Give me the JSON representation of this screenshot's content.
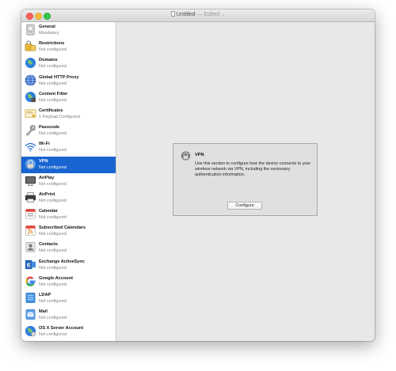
{
  "window": {
    "title": "Untitled",
    "edited": "— Edited",
    "chevron": "⌄"
  },
  "sidebar": {
    "items": [
      {
        "name": "General",
        "status": "Mandatory",
        "icon": "general-icon"
      },
      {
        "name": "Restrictions",
        "status": "Not configured",
        "icon": "restrictions-icon"
      },
      {
        "name": "Domains",
        "status": "Not configured",
        "icon": "domains-icon"
      },
      {
        "name": "Global HTTP Proxy",
        "status": "Not configured",
        "icon": "globe-icon"
      },
      {
        "name": "Content Filter",
        "status": "Not configured",
        "icon": "content-filter-icon"
      },
      {
        "name": "Certificates",
        "status": "1 Payload Configured",
        "icon": "certificate-icon"
      },
      {
        "name": "Passcode",
        "status": "Not configured",
        "icon": "key-icon"
      },
      {
        "name": "Wi-Fi",
        "status": "Not configured",
        "icon": "wifi-icon"
      },
      {
        "name": "VPN",
        "status": "Not configured",
        "icon": "vpn-lock-icon",
        "selected": true
      },
      {
        "name": "AirPlay",
        "status": "Not configured",
        "icon": "airplay-icon"
      },
      {
        "name": "AirPrint",
        "status": "Not configured",
        "icon": "printer-icon"
      },
      {
        "name": "Calendar",
        "status": "Not configured",
        "icon": "calendar-icon"
      },
      {
        "name": "Subscribed Calendars",
        "status": "Not configured",
        "icon": "subscribed-calendar-icon"
      },
      {
        "name": "Contacts",
        "status": "Not configured",
        "icon": "contacts-icon"
      },
      {
        "name": "Exchange ActiveSync",
        "status": "Not configured",
        "icon": "exchange-icon"
      },
      {
        "name": "Google Account",
        "status": "Not configured",
        "icon": "google-icon"
      },
      {
        "name": "LDAP",
        "status": "Not configured",
        "icon": "ldap-icon"
      },
      {
        "name": "Mail",
        "status": "Not configured",
        "icon": "mail-icon"
      },
      {
        "name": "OS X Server Account",
        "status": "Not configured",
        "icon": "server-account-icon"
      }
    ]
  },
  "panel": {
    "title": "VPN",
    "description": "Use this section to configure how the device connects to your wireless network via VPN, including the necessary authentication information.",
    "button_label": "Configure"
  },
  "colors": {
    "selection": "#1864d1",
    "window_bg": "#e8e8e8"
  }
}
